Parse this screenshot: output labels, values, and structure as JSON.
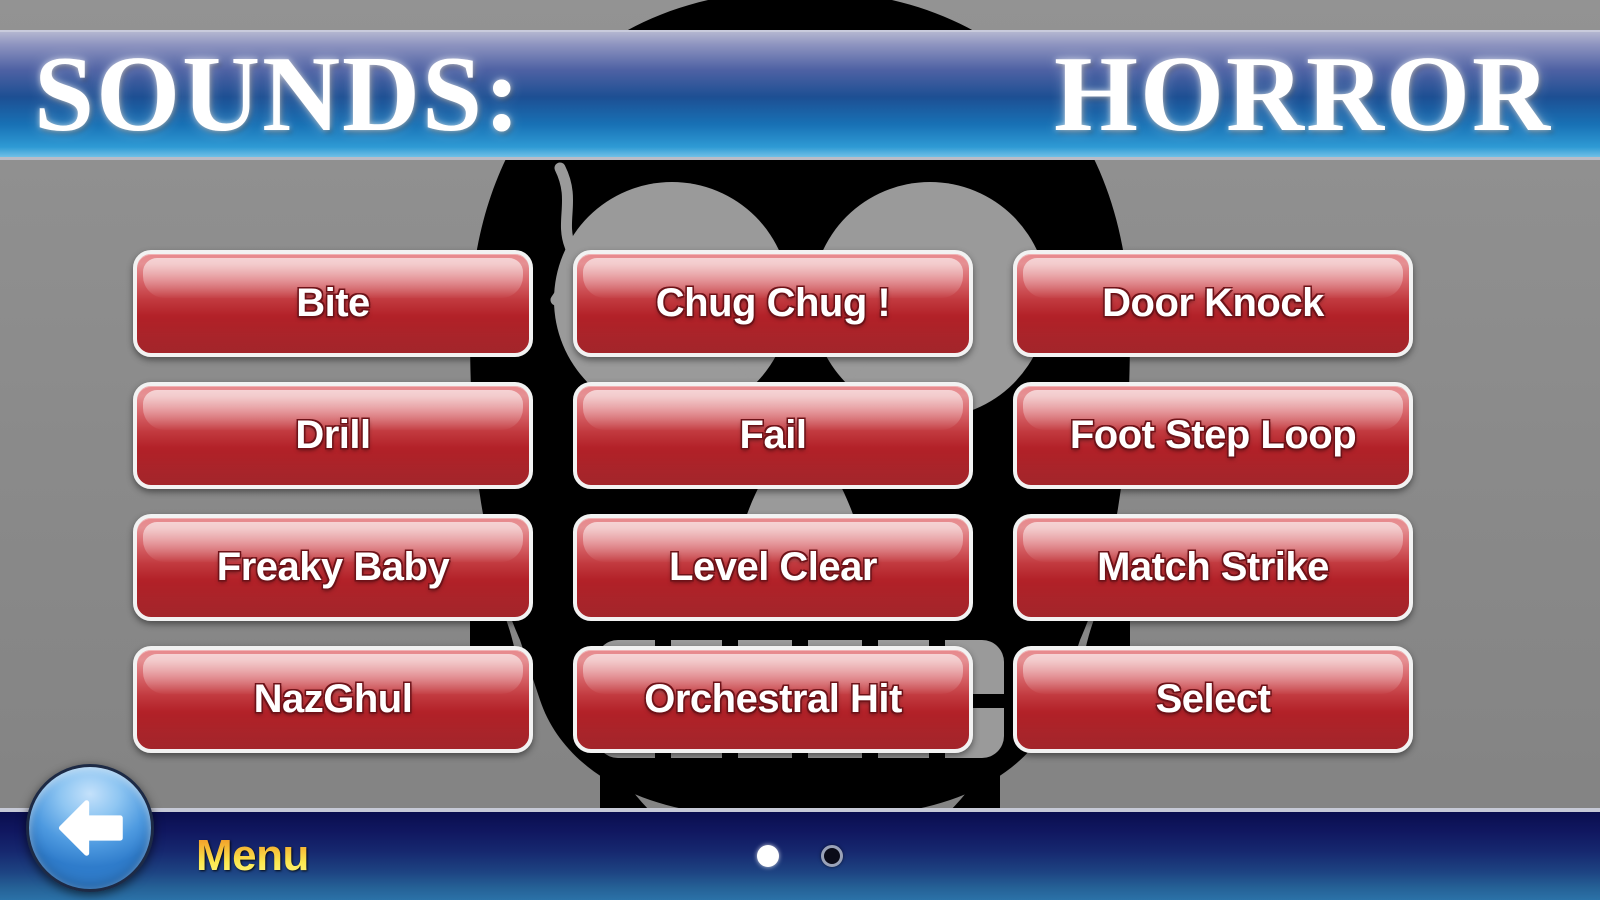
{
  "header": {
    "title_left": "SOUNDS:",
    "title_right": "HORROR",
    "gradient_top": "#b3b6d0",
    "gradient_bottom": "#6fc0e6"
  },
  "background": {
    "image_name": "skull-silhouette",
    "base_color": "#8d8d8d",
    "skull_color": "#000000",
    "skull_feature_color": "#9a9a9a"
  },
  "grid": {
    "columns": 3,
    "rows": 4,
    "buttons": [
      {
        "label": "Bite",
        "name": "sound-button-bite"
      },
      {
        "label": "Chug Chug !",
        "name": "sound-button-chug-chug"
      },
      {
        "label": "Door Knock",
        "name": "sound-button-door-knock"
      },
      {
        "label": "Drill",
        "name": "sound-button-drill"
      },
      {
        "label": "Fail",
        "name": "sound-button-fail"
      },
      {
        "label": "Foot Step Loop",
        "name": "sound-button-foot-step-loop"
      },
      {
        "label": "Freaky Baby",
        "name": "sound-button-freaky-baby"
      },
      {
        "label": "Level Clear",
        "name": "sound-button-level-clear"
      },
      {
        "label": "Match Strike",
        "name": "sound-button-match-strike"
      },
      {
        "label": "NazGhul",
        "name": "sound-button-nazghul"
      },
      {
        "label": "Orchestral Hit",
        "name": "sound-button-orchestral-hit"
      },
      {
        "label": "Select",
        "name": "sound-button-select"
      }
    ],
    "button_color_top": "#e8888c",
    "button_color_bottom": "#9c151b",
    "button_border_color": "#f2f2f2"
  },
  "bottom_bar": {
    "menu_label": "Menu",
    "menu_color_top": "#f08a22",
    "menu_color_bottom": "#fff98e",
    "bar_color_top": "#0a0e4e",
    "bar_color_bottom": "#2b72a8",
    "back_icon": "left-arrow-icon",
    "back_button_color": "#4e9ae0",
    "pagination": {
      "total": 2,
      "current": 1,
      "dots": [
        {
          "state": "active"
        },
        {
          "state": "inactive"
        }
      ]
    }
  }
}
